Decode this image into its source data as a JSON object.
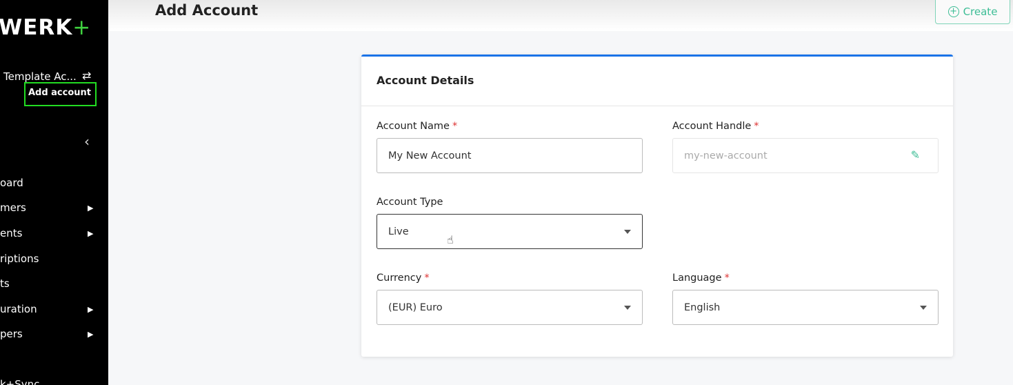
{
  "sidebar": {
    "logo": "WERK",
    "logo_plus": "+",
    "account_name": "Template Ac...",
    "add_account": "Add account",
    "items": [
      {
        "label": "oard",
        "caret": false
      },
      {
        "label": "mers",
        "caret": true
      },
      {
        "label": "ents",
        "caret": true
      },
      {
        "label": "riptions",
        "caret": false
      },
      {
        "label": "ts",
        "caret": false
      },
      {
        "label": "uration",
        "caret": true
      },
      {
        "label": "pers",
        "caret": true
      },
      {
        "label": "k+Sync",
        "caret": false
      }
    ]
  },
  "header": {
    "title": "Add Account",
    "create_label": "Create"
  },
  "card": {
    "title": "Account Details",
    "account_name": {
      "label": "Account Name",
      "value": "My New Account",
      "required": true
    },
    "account_handle": {
      "label": "Account Handle",
      "placeholder": "my-new-account",
      "required": true
    },
    "account_type": {
      "label": "Account Type",
      "value": "Live"
    },
    "currency": {
      "label": "Currency",
      "value": "(EUR) Euro",
      "required": true
    },
    "language": {
      "label": "Language",
      "value": "English",
      "required": true
    }
  },
  "colors": {
    "accent": "#1a73e8",
    "brand_green": "#3fd13f",
    "create_teal": "#3dbd95",
    "required": "#dd3333"
  }
}
